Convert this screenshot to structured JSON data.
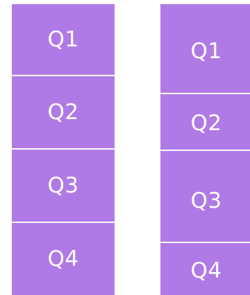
{
  "color": "#b07ae6",
  "left_column": {
    "segments": [
      {
        "label": "Q1"
      },
      {
        "label": "Q2"
      },
      {
        "label": "Q3"
      },
      {
        "label": "Q4"
      }
    ]
  },
  "right_column": {
    "segments": [
      {
        "label": "Q1"
      },
      {
        "label": "Q2"
      },
      {
        "label": "Q3"
      },
      {
        "label": "Q4"
      }
    ]
  }
}
